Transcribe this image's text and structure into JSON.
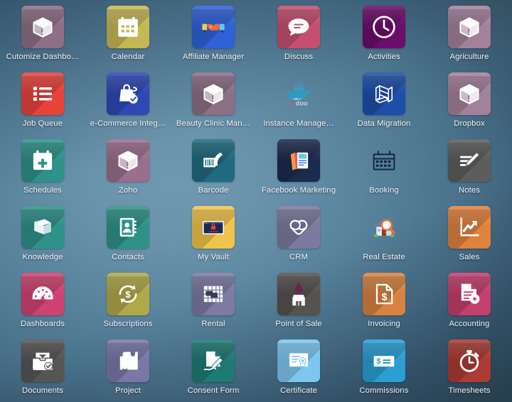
{
  "desktop": {
    "background_top_left": "#5a849e",
    "background_center": "#7098b0",
    "background_corner_dark": "#33505f",
    "columns": 6,
    "rows": 6
  },
  "apps": [
    {
      "label": "Cutomize Dashbo…",
      "icon": "broken-package-icon",
      "tile_color": "#8d6f86",
      "style": "tile"
    },
    {
      "label": "Calendar",
      "icon": "calendar-icon",
      "tile_color": "#c6b755",
      "style": "tile"
    },
    {
      "label": "Affiliate Manager",
      "icon": "handshake-color-icon",
      "tile_color": "#2f62d8",
      "style": "tile"
    },
    {
      "label": "Discuss",
      "icon": "speech-bubble-icon",
      "tile_color": "#c44f6e",
      "style": "tile"
    },
    {
      "label": "Activities",
      "icon": "clock-icon",
      "tile_color": "#6b0d6b",
      "style": "tile"
    },
    {
      "label": "Agriculture",
      "icon": "broken-package-icon",
      "tile_color": "#a3819b",
      "style": "tile"
    },
    {
      "label": "Job Queue",
      "icon": "list-icon",
      "tile_color": "#e8423b",
      "style": "tile"
    },
    {
      "label": "e-Commerce Integ…",
      "icon": "shopping-bag-check-icon",
      "tile_color": "#2f48b5",
      "style": "tile"
    },
    {
      "label": "Beauty Clinic Man…",
      "icon": "broken-package-icon",
      "tile_color": "#8d6f86",
      "style": "tile"
    },
    {
      "label": "Instance Manage…",
      "icon": "docker-odoo-icon",
      "tile_color": "transparent",
      "style": "plain"
    },
    {
      "label": "Data Migration",
      "icon": "migration-n-icon",
      "tile_color": "#1d4fa8",
      "style": "tile"
    },
    {
      "label": "Dropbox",
      "icon": "broken-package-icon",
      "tile_color": "#a3819b",
      "style": "tile"
    },
    {
      "label": "Schedules",
      "icon": "calendar-plus-icon",
      "tile_color": "#2e9289",
      "style": "tile"
    },
    {
      "label": "Zoho",
      "icon": "broken-package-icon",
      "tile_color": "#9a6e8c",
      "style": "tile"
    },
    {
      "label": "Barcode",
      "icon": "barcode-scanner-icon",
      "tile_color": "#1f6a80",
      "style": "tile"
    },
    {
      "label": "Facebook Marketing",
      "icon": "facebook-marketing-icon",
      "tile_color": "#1c2a4d",
      "style": "tile"
    },
    {
      "label": "Booking",
      "icon": "calendar-outline-icon",
      "tile_color": "transparent",
      "style": "plain"
    },
    {
      "label": "Notes",
      "icon": "notes-pencil-icon",
      "tile_color": "#5d5d5d",
      "style": "tile"
    },
    {
      "label": "Knowledge",
      "icon": "book-icon",
      "tile_color": "#2e9289",
      "style": "tile"
    },
    {
      "label": "Contacts",
      "icon": "address-book-icon",
      "tile_color": "#2e9289",
      "style": "tile"
    },
    {
      "label": "My Vault",
      "icon": "password-vault-icon",
      "tile_color": "#f0c44a",
      "style": "tile"
    },
    {
      "label": "CRM",
      "icon": "handshake-icon",
      "tile_color": "#7c7a9e",
      "style": "tile"
    },
    {
      "label": "Real Estate",
      "icon": "house-magnifier-icon",
      "tile_color": "transparent",
      "style": "plain"
    },
    {
      "label": "Sales",
      "icon": "chart-arrow-up-icon",
      "tile_color": "#e0823e",
      "style": "tile"
    },
    {
      "label": "Dashboards",
      "icon": "gauge-icon",
      "tile_color": "#cf4370",
      "style": "tile"
    },
    {
      "label": "Subscriptions",
      "icon": "recurring-dollar-icon",
      "tile_color": "#b1a84a",
      "style": "tile"
    },
    {
      "label": "Rental",
      "icon": "rental-grid-icon",
      "tile_color": "#7d7aa3",
      "style": "tile"
    },
    {
      "label": "Point of Sale",
      "icon": "shop-droplet-icon",
      "tile_color": "#55524f",
      "style": "tile"
    },
    {
      "label": "Invoicing",
      "icon": "invoice-dollar-icon",
      "tile_color": "#d98242",
      "style": "tile"
    },
    {
      "label": "Accounting",
      "icon": "accounting-gear-icon",
      "tile_color": "#c33f6e",
      "style": "tile"
    },
    {
      "label": "Documents",
      "icon": "document-tray-check-icon",
      "tile_color": "#555555",
      "style": "tile"
    },
    {
      "label": "Project",
      "icon": "puzzle-piece-icon",
      "tile_color": "#7a77a8",
      "style": "tile"
    },
    {
      "label": "Consent Form",
      "icon": "signed-form-icon",
      "tile_color": "#1f7a74",
      "style": "tile"
    },
    {
      "label": "Certificate",
      "icon": "certificate-icon",
      "tile_color": "#7ec6ef",
      "style": "tile"
    },
    {
      "label": "Commissions",
      "icon": "cheque-icon",
      "tile_color": "#2b9fd4",
      "style": "tile"
    },
    {
      "label": "Timesheets",
      "icon": "stopwatch-icon",
      "tile_color": "#ab3b33",
      "style": "tile"
    }
  ]
}
